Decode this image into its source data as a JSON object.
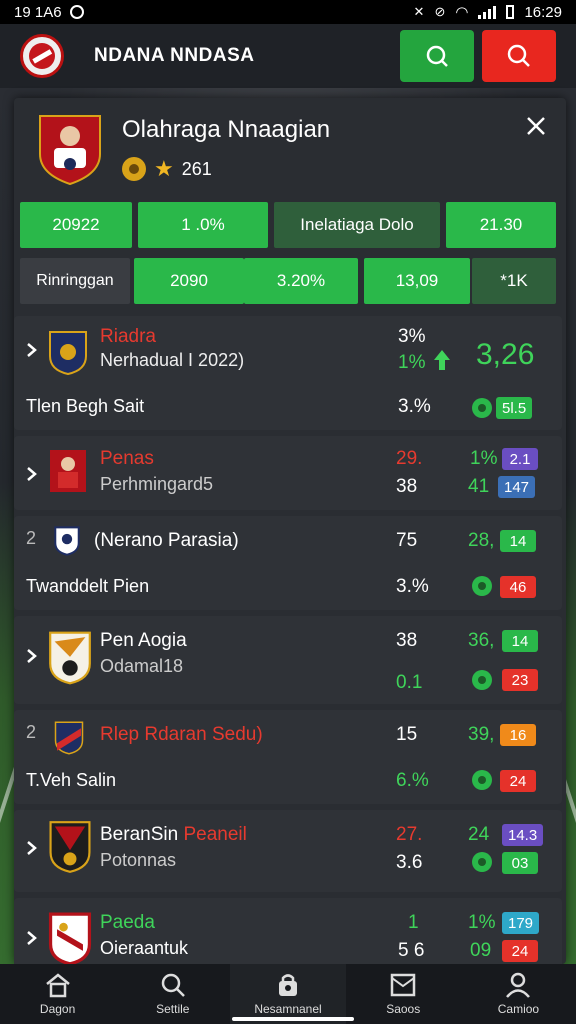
{
  "status_bar": {
    "time_left": "19 1A6",
    "time_right": "16:29"
  },
  "app_bar": {
    "title": "NDANA NNDASA",
    "search_icon": "search-icon"
  },
  "profile": {
    "name": "Olahraga Nnaagian",
    "points": "261"
  },
  "stat_row_1": [
    "20922",
    "1 .0%",
    "Inelatiaga Dolo",
    "21.30"
  ],
  "stat_row_2": [
    "Rinringgan",
    "2090",
    "3.20%",
    "13,09",
    "*1K"
  ],
  "matches": [
    {
      "chevron": true,
      "rank": "",
      "title": "Riadra",
      "title_color": "#e63a2f",
      "subtitle": "Nerhadual I 2022)",
      "stat_a": "3%",
      "stat_b": "1%",
      "score": "3,26",
      "line2_label": "Tlen Begh Sait",
      "line2_val": "3.%",
      "pill": "5l.5",
      "pill_color": "g"
    },
    {
      "chevron": true,
      "rank": "",
      "title": "Penas",
      "title_color": "#e63a2f",
      "subtitle": "Perhmingard5",
      "stat_a": "29.",
      "stat_b": "38",
      "col2_a": "1%",
      "col2_b": "41",
      "pill_a": "2.1",
      "pill_b": "147"
    },
    {
      "chevron": false,
      "rank": "2",
      "title": "(Nerano Parasia)",
      "title_color": "#ffffff",
      "stat_a": "75",
      "col2_a": "28,",
      "pill_a": "14",
      "line2_label": "Twanddelt Pien",
      "line2_val": "3.%",
      "pill_b": "46"
    },
    {
      "chevron": true,
      "rank": "",
      "title": "Pen Aogia",
      "title_color": "#ffffff",
      "subtitle": "Odamal18",
      "stat_a": "38",
      "stat_b": "0.1",
      "col2_a": "36,",
      "pill_a": "14",
      "pill_b": "23"
    },
    {
      "chevron": false,
      "rank": "2",
      "title": "Rlep Rdaran Sedu)",
      "title_color": "#e63a2f",
      "stat_a": "15",
      "col2_a": "39,",
      "pill_a": "16",
      "line2_label": "T.Veh Salin",
      "line2_val": "6.%",
      "pill_b": "24"
    },
    {
      "chevron": true,
      "rank": "",
      "title": "BeranSin",
      "title2": "Peaneil",
      "title_color": "#ffffff",
      "subtitle": "Potonnas",
      "stat_a": "27.",
      "stat_b": "3.6",
      "col2_a": "24",
      "pill_a": "14.3",
      "pill_b": "03"
    },
    {
      "chevron": true,
      "rank": "",
      "title": "Paeda",
      "title_color": "#3fd45a",
      "subtitle": "Oieraantuk",
      "stat_a": "1",
      "stat_b": "5 6",
      "col2_a": "1%",
      "col2_b": "09",
      "pill_a": "179",
      "pill_b": "24"
    }
  ],
  "bottom_nav": [
    {
      "label": "Dagon",
      "icon": "home-icon"
    },
    {
      "label": "Settile",
      "icon": "search-icon"
    },
    {
      "label": "Nesamnanel",
      "icon": "lock-icon"
    },
    {
      "label": "Saoos",
      "icon": "inbox-icon"
    },
    {
      "label": "Camioo",
      "icon": "user-icon"
    }
  ]
}
